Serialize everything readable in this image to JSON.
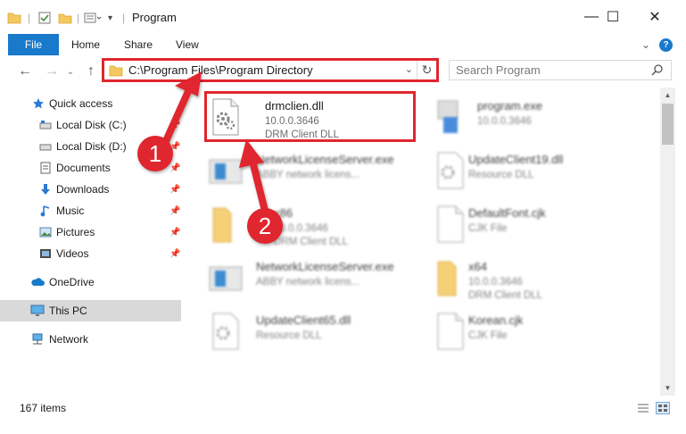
{
  "window": {
    "title": "Program",
    "minimize_glyph": "—",
    "maximize_glyph": "☐",
    "close_glyph": "✕"
  },
  "ribbon": {
    "tabs": [
      {
        "label": "File"
      },
      {
        "label": "Home"
      },
      {
        "label": "Share"
      },
      {
        "label": "View"
      }
    ],
    "expand_glyph": "⌄",
    "help_glyph": "?"
  },
  "navigation": {
    "back_glyph": "←",
    "forward_glyph": "→",
    "recent_glyph": "⌄",
    "up_glyph": "↑",
    "address_path": "C:\\Program Files\\Program Directory",
    "address_dropdown_glyph": "⌄",
    "refresh_glyph": "↻"
  },
  "search": {
    "placeholder": "Search Program"
  },
  "sidebar": {
    "items": [
      {
        "label": "Quick access",
        "icon": "star-icon"
      },
      {
        "label": "Local Disk (C:)",
        "icon": "drive-icon"
      },
      {
        "label": "Local Disk (D:)",
        "icon": "drive-icon"
      },
      {
        "label": "Documents",
        "icon": "documents-icon"
      },
      {
        "label": "Downloads",
        "icon": "downloads-icon"
      },
      {
        "label": "Music",
        "icon": "music-icon"
      },
      {
        "label": "Pictures",
        "icon": "pictures-icon"
      },
      {
        "label": "Videos",
        "icon": "videos-icon"
      },
      {
        "label": "OneDrive",
        "icon": "cloud-icon"
      },
      {
        "label": "This PC",
        "icon": "computer-icon",
        "selected": true
      },
      {
        "label": "Network",
        "icon": "network-icon"
      }
    ],
    "pin_glyph": "📌"
  },
  "files": [
    {
      "name": "drmclien.dll",
      "line1": "10.0.0.3646",
      "line2": "DRM Client DLL",
      "icon": "dll-gear-icon",
      "highlighted": true
    },
    {
      "name": "program.exe",
      "line1": "10.0.0.3646",
      "line2": "",
      "icon": "exe-icon"
    },
    {
      "name": "NetworkLicenseServer.exe",
      "line1": "ABBY network licens...",
      "line2": "",
      "icon": "exe-window-icon"
    },
    {
      "name": "UpdateClient19.dll",
      "line1": "Resource DLL",
      "line2": "",
      "icon": "dll-gear-icon"
    },
    {
      "name": "x86",
      "line1": "10.0.0.3646",
      "line2": "DRM Client DLL",
      "icon": "folder-icon"
    },
    {
      "name": "DefaultFont.cjk",
      "line1": "CJK File",
      "line2": "",
      "icon": "blank-file-icon"
    },
    {
      "name": "NetworkLicenseServer.exe",
      "line1": "ABBY network licens...",
      "line2": "",
      "icon": "exe-window-icon"
    },
    {
      "name": "x64",
      "line1": "10.0.0.3646",
      "line2": "DRM Client DLL",
      "icon": "folder-icon"
    },
    {
      "name": "UpdateClient65.dll",
      "line1": "Resource DLL",
      "line2": "",
      "icon": "dll-gear-icon"
    },
    {
      "name": "Korean.cjk",
      "line1": "CJK File",
      "line2": "",
      "icon": "blank-file-icon"
    }
  ],
  "status": {
    "item_count": "167 items"
  },
  "annotations": {
    "badge1": "1",
    "badge2": "2",
    "accent_color": "#e0262e"
  }
}
